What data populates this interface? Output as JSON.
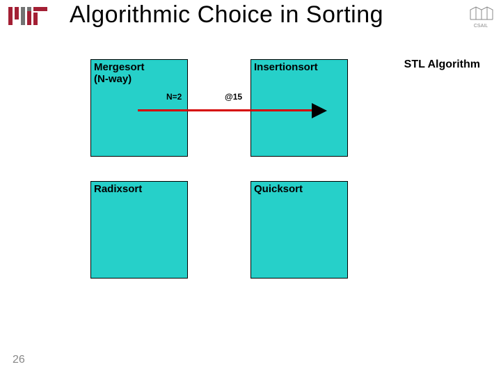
{
  "title": "Algorithmic Choice in Sorting",
  "stl_label": "STL Algorithm",
  "boxes": {
    "b1_line1": "Mergesort",
    "b1_line2": "(N-way)",
    "b2": "Insertionsort",
    "b3": "Radixsort",
    "b4": "Quicksort"
  },
  "annotations": {
    "n_eq": "N=2",
    "at": "@15"
  },
  "page_number": "26",
  "logos": {
    "mit_alt": "MIT",
    "csail_alt": "CSAIL"
  }
}
